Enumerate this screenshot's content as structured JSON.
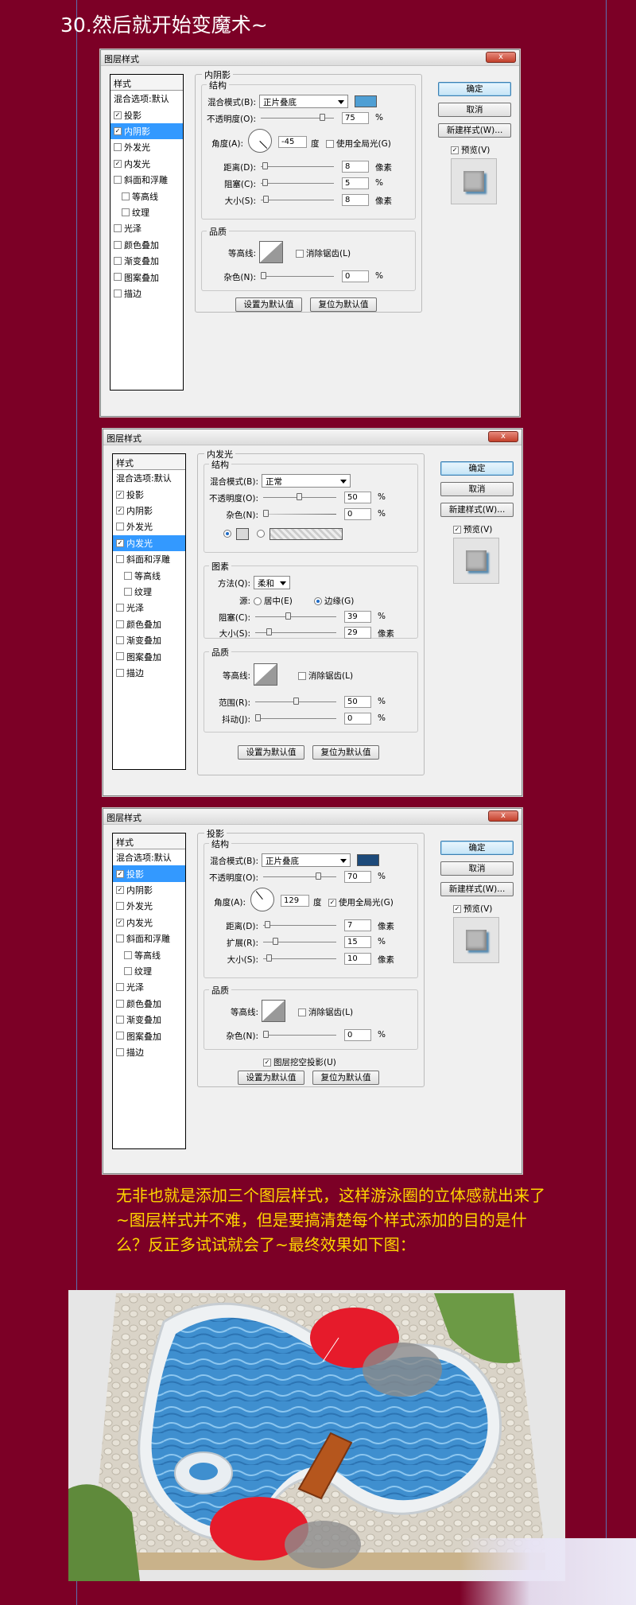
{
  "heading": "30.然后就开始变魔术~",
  "list_header": "样式",
  "list_items": [
    "混合选项:默认",
    "投影",
    "内阴影",
    "外发光",
    "内发光",
    "斜面和浮雕",
    "等高线",
    "纹理",
    "光泽",
    "颜色叠加",
    "渐变叠加",
    "图案叠加",
    "描边"
  ],
  "window_title": "图层样式",
  "close_label": "x",
  "buttons": {
    "ok": "确定",
    "cancel": "取消",
    "new_style": "新建样式(W)...",
    "preview": "预览(V)",
    "set_default": "设置为默认值",
    "reset_default": "复位为默认值"
  },
  "dialog1": {
    "section": "内阴影",
    "group1": "结构",
    "group2": "品质",
    "blend_label": "混合模式(B):",
    "blend_value": "正片叠底",
    "blend_color": "#4f9fd4",
    "opacity_label": "不透明度(O):",
    "opacity_value": "75",
    "opacity_unit": "%",
    "angle_label": "角度(A):",
    "angle_value": "-45",
    "angle_unit": "度",
    "global_label": "使用全局光(G)",
    "distance_label": "距离(D):",
    "distance_value": "8",
    "distance_unit": "像素",
    "choke_label": "阻塞(C):",
    "choke_value": "5",
    "choke_unit": "%",
    "size_label": "大小(S):",
    "size_value": "8",
    "size_unit": "像素",
    "contour_label": "等高线:",
    "antialias_label": "消除锯齿(L)",
    "noise_label": "杂色(N):",
    "noise_value": "0",
    "noise_unit": "%"
  },
  "dialog2": {
    "section": "内发光",
    "group1": "结构",
    "group2": "图素",
    "group3": "品质",
    "blend_label": "混合模式(B):",
    "blend_value": "正常",
    "opacity_label": "不透明度(O):",
    "opacity_value": "50",
    "opacity_unit": "%",
    "noise_label": "杂色(N):",
    "noise_value": "0",
    "noise_unit": "%",
    "technique_label": "方法(Q):",
    "technique_value": "柔和",
    "source_label": "源:",
    "center_label": "居中(E)",
    "edge_label": "边缘(G)",
    "choke_label": "阻塞(C):",
    "choke_value": "39",
    "choke_unit": "%",
    "size_label": "大小(S):",
    "size_value": "29",
    "size_unit": "像素",
    "contour_label": "等高线:",
    "antialias_label": "消除锯齿(L)",
    "range_label": "范围(R):",
    "range_value": "50",
    "range_unit": "%",
    "jitter_label": "抖动(J):",
    "jitter_value": "0",
    "jitter_unit": "%"
  },
  "dialog3": {
    "section": "投影",
    "group1": "结构",
    "group2": "品质",
    "blend_label": "混合模式(B):",
    "blend_value": "正片叠底",
    "blend_color": "#1d4a7a",
    "opacity_label": "不透明度(O):",
    "opacity_value": "70",
    "opacity_unit": "%",
    "angle_label": "角度(A):",
    "angle_value": "129",
    "angle_unit": "度",
    "global_label": "使用全局光(G)",
    "distance_label": "距离(D):",
    "distance_value": "7",
    "distance_unit": "像素",
    "spread_label": "扩展(R):",
    "spread_value": "15",
    "spread_unit": "%",
    "size_label": "大小(S):",
    "size_value": "10",
    "size_unit": "像素",
    "contour_label": "等高线:",
    "antialias_label": "消除锯齿(L)",
    "noise_label": "杂色(N):",
    "noise_value": "0",
    "noise_unit": "%",
    "knockout_label": "图层挖空投影(U)"
  },
  "paragraph": "无非也就是添加三个图层样式，这样游泳圈的立体感就出来了~图层样式并不难，但是要搞清楚每个样式添加的目的是什么？反正多试试就会了~最终效果如下图："
}
